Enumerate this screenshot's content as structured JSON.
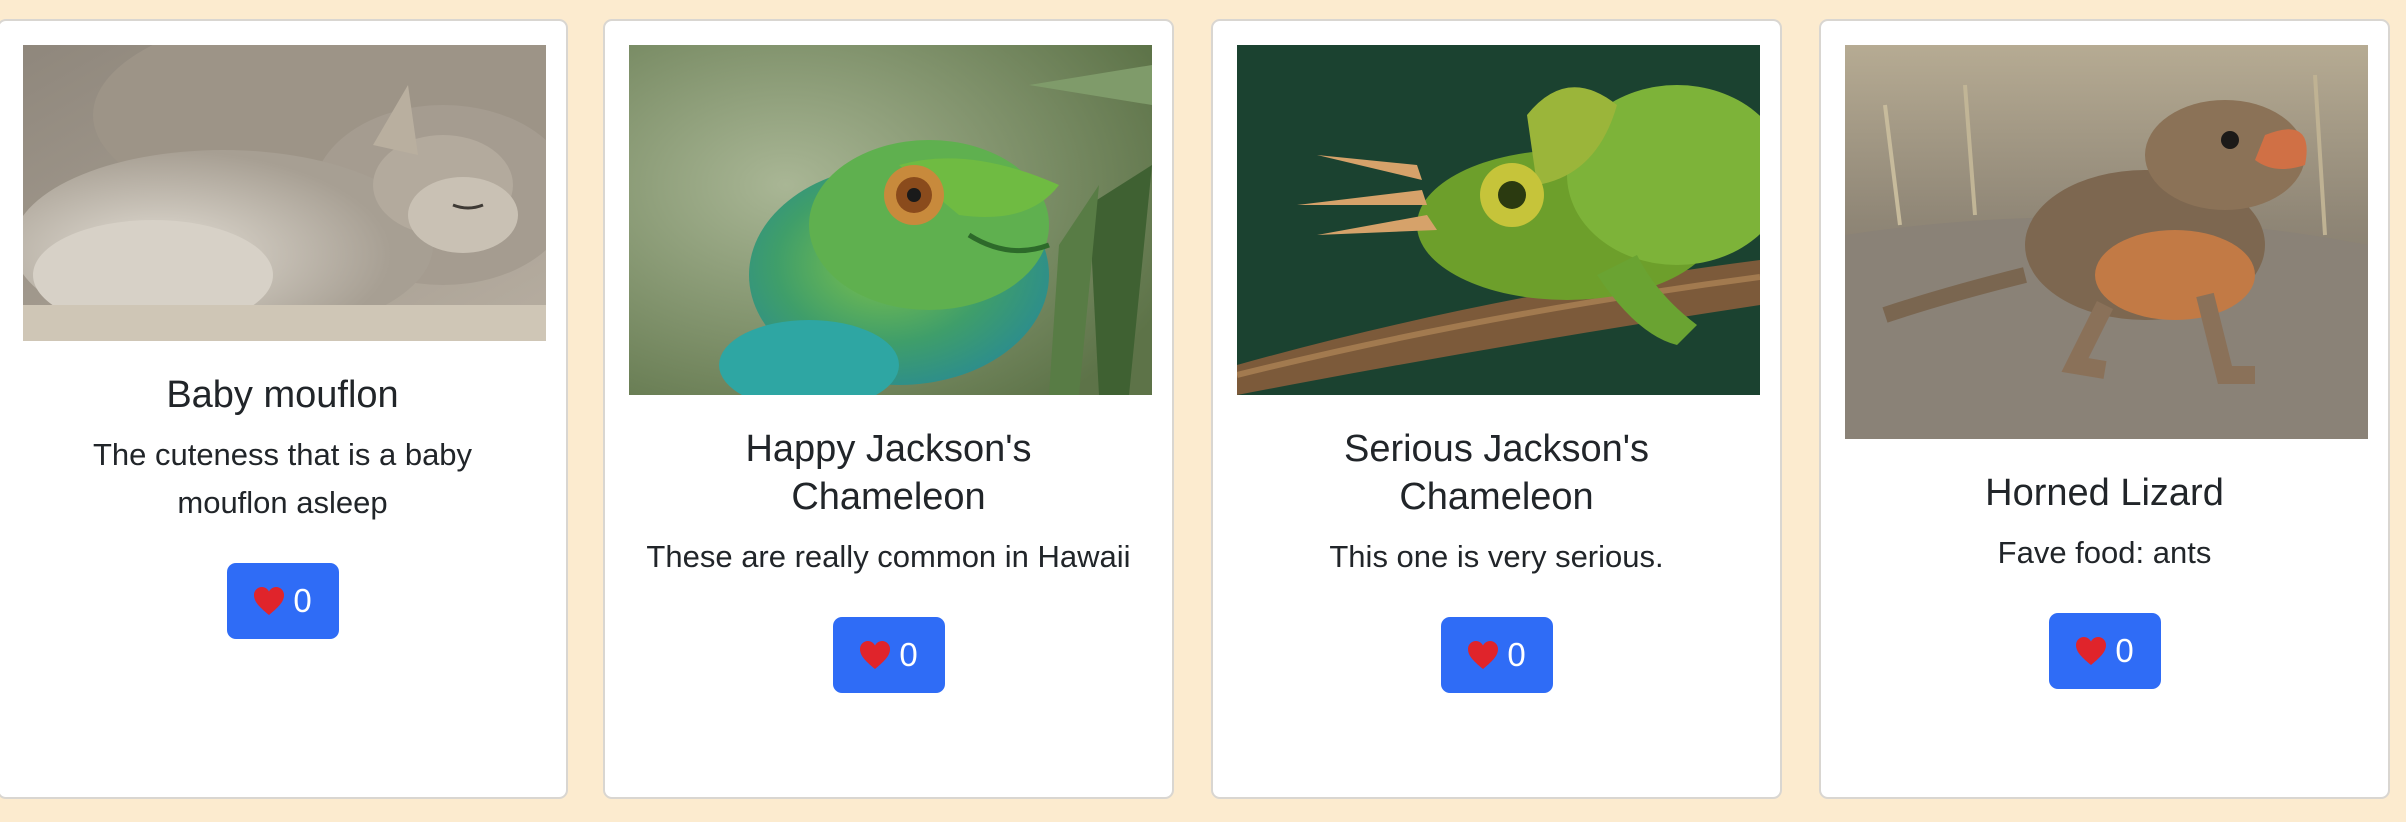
{
  "cards": [
    {
      "title": "Baby mouflon",
      "description": "The cuteness that is a baby mouflon asleep",
      "likes": "0",
      "photo_subject": "baby-mouflon"
    },
    {
      "title": "Happy Jackson's Chameleon",
      "description": "These are really common in Hawaii",
      "likes": "0",
      "photo_subject": "happy-chameleon"
    },
    {
      "title": "Serious Jackson's Chameleon",
      "description": "This one is very serious.",
      "likes": "0",
      "photo_subject": "serious-chameleon"
    },
    {
      "title": "Horned Lizard",
      "description": "Fave food: ants",
      "likes": "0",
      "photo_subject": "horned-lizard"
    }
  ],
  "colors": {
    "page_background": "#fcebcf",
    "card_background": "#ffffff",
    "card_border": "#d9d6d1",
    "button_background": "#2f6cf6",
    "button_text": "#ffffff",
    "heart": "#e0242b",
    "text": "#212529"
  },
  "icons": {
    "like": "heart-icon"
  }
}
